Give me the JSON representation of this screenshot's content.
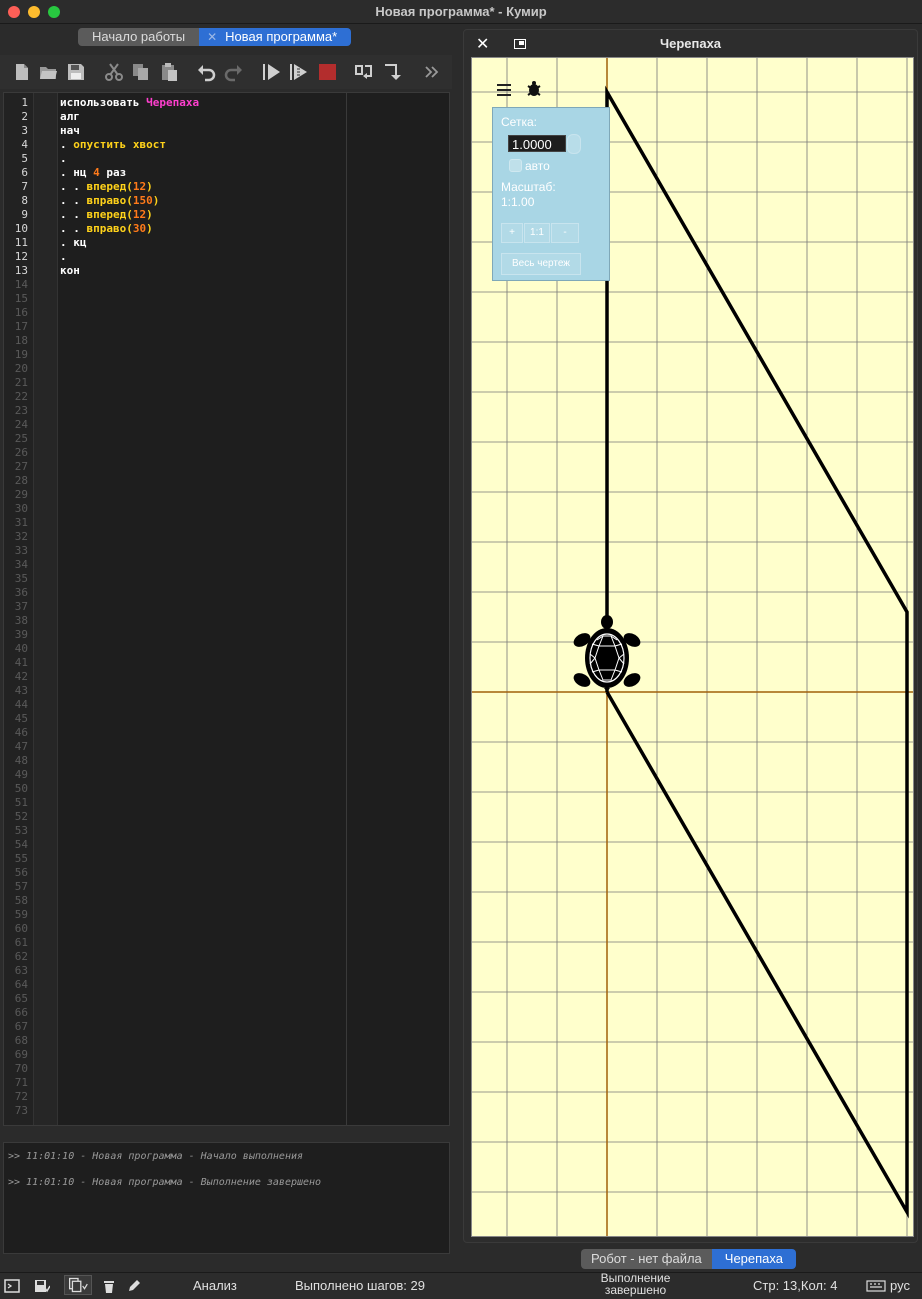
{
  "window": {
    "title": "Новая программа* - Кумир"
  },
  "tabs": [
    {
      "label": "Начало работы"
    },
    {
      "label": "Новая программа*"
    }
  ],
  "toolbar": {
    "buttons": [
      "new-file-icon",
      "open-file-icon",
      "save-icon",
      "cut-icon",
      "copy-icon",
      "paste-icon",
      "undo-icon",
      "redo-icon",
      "run-icon",
      "step-run-icon",
      "stop-icon",
      "step-over-icon",
      "step-into-icon",
      "more-icon"
    ]
  },
  "editor": {
    "total_lines": 73,
    "lines": [
      [
        {
          "t": "использовать ",
          "c": "kw"
        },
        {
          "t": "Черепаха",
          "c": "mod"
        }
      ],
      [
        {
          "t": "алг",
          "c": "kw"
        }
      ],
      [
        {
          "t": "нач",
          "c": "kw"
        }
      ],
      [
        {
          "t": ". ",
          "c": "kw"
        },
        {
          "t": "опустить хвост",
          "c": "fn"
        }
      ],
      [
        {
          "t": ".",
          "c": "kw"
        }
      ],
      [
        {
          "t": ". нц ",
          "c": "kw"
        },
        {
          "t": "4",
          "c": "num"
        },
        {
          "t": " раз",
          "c": "kw"
        }
      ],
      [
        {
          "t": ". . ",
          "c": "kw"
        },
        {
          "t": "вперед",
          "c": "fn"
        },
        {
          "t": "(",
          "c": "par"
        },
        {
          "t": "12",
          "c": "num"
        },
        {
          "t": ")",
          "c": "par"
        }
      ],
      [
        {
          "t": ". . ",
          "c": "kw"
        },
        {
          "t": "вправо",
          "c": "fn"
        },
        {
          "t": "(",
          "c": "par"
        },
        {
          "t": "150",
          "c": "num"
        },
        {
          "t": ")",
          "c": "par"
        }
      ],
      [
        {
          "t": ". . ",
          "c": "kw"
        },
        {
          "t": "вперед",
          "c": "fn"
        },
        {
          "t": "(",
          "c": "par"
        },
        {
          "t": "12",
          "c": "num"
        },
        {
          "t": ")",
          "c": "par"
        }
      ],
      [
        {
          "t": ". . ",
          "c": "kw"
        },
        {
          "t": "вправо",
          "c": "fn"
        },
        {
          "t": "(",
          "c": "par"
        },
        {
          "t": "30",
          "c": "num"
        },
        {
          "t": ")",
          "c": "par"
        }
      ],
      [
        {
          "t": ". кц",
          "c": "kw"
        }
      ],
      [
        {
          "t": ".",
          "c": "kw"
        }
      ],
      [
        {
          "t": "кон",
          "c": "kw"
        }
      ]
    ]
  },
  "console": {
    "lines": [
      ">> 11:01:10 - Новая программа - Начало выполнения",
      ">> 11:01:10 - Новая программа - Выполнение завершено"
    ]
  },
  "turtle_panel": {
    "title": "Черепаха",
    "settings": {
      "grid_label": "Сетка:",
      "grid_value": "1.0000",
      "auto_label": "авто",
      "scale_label": "Масштаб:",
      "scale_value": "1:1.00",
      "zoom_in": "+",
      "zoom_reset": "1:1",
      "zoom_out": "-",
      "fit_all": "Весь чертеж"
    }
  },
  "bottom_tabs": [
    {
      "label": "Робот - нет файла"
    },
    {
      "label": "Черепаха"
    }
  ],
  "status": {
    "analysis": "Анализ",
    "steps": "Выполнено шагов: 29",
    "state_line1": "Выполнение",
    "state_line2": "завершено",
    "position": "Стр: 13,Кол: 4",
    "language": "рус"
  },
  "colors": {
    "canvas_bg": "#ffffcc",
    "grid": "#777777",
    "axis": "#a0600a",
    "accent": "#2e6fd4"
  }
}
